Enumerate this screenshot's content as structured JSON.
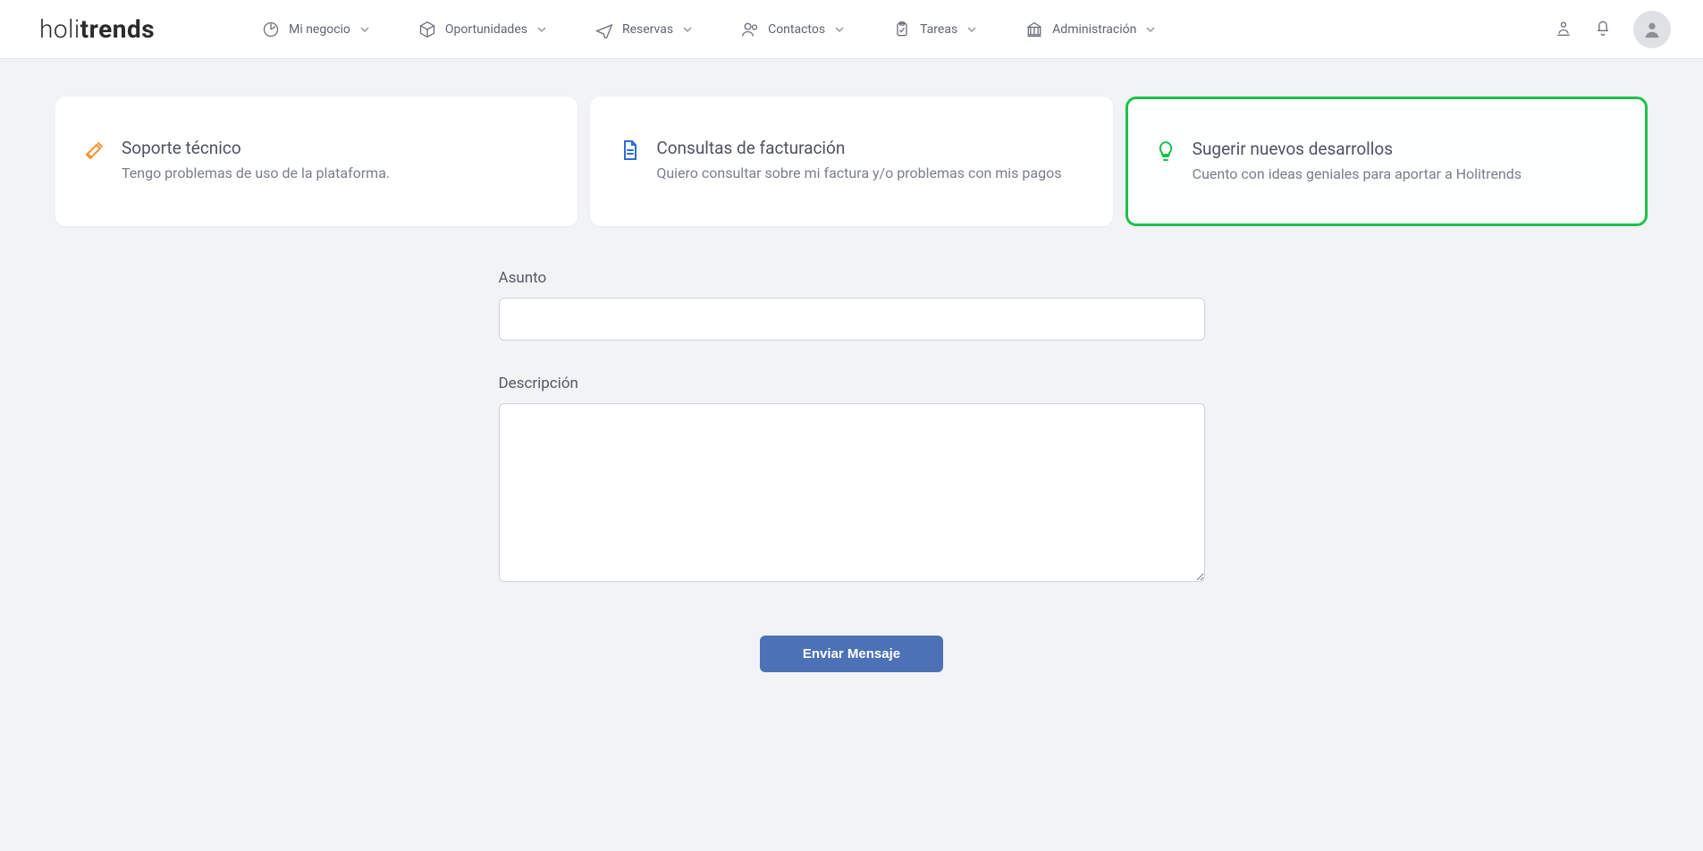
{
  "brand": {
    "name_light": "holi",
    "name_bold": "trends"
  },
  "nav": {
    "items": [
      {
        "label": "Mi negocio"
      },
      {
        "label": "Oportunidades"
      },
      {
        "label": "Reservas"
      },
      {
        "label": "Contactos"
      },
      {
        "label": "Tareas"
      },
      {
        "label": "Administración"
      }
    ]
  },
  "cards": [
    {
      "title": "Soporte técnico",
      "desc": "Tengo problemas de uso de la plataforma."
    },
    {
      "title": "Consultas de facturación",
      "desc": "Quiero consultar sobre mi factura y/o problemas con mis pagos"
    },
    {
      "title": "Sugerir nuevos desarrollos",
      "desc": "Cuento con ideas geniales para aportar a Holitrends"
    }
  ],
  "form": {
    "subject_label": "Asunto",
    "description_label": "Descripción",
    "submit_label": "Enviar Mensaje"
  }
}
